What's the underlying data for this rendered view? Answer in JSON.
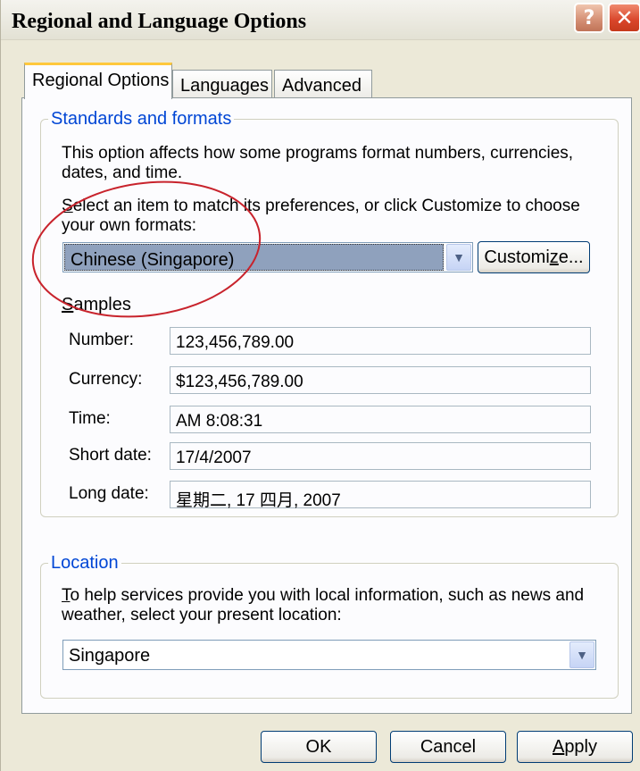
{
  "window": {
    "title": "Regional and Language Options"
  },
  "titlebar_buttons": {
    "help": "?",
    "close": "✕"
  },
  "tabs": [
    {
      "label": "Regional Options"
    },
    {
      "label": "Languages"
    },
    {
      "label": "Advanced"
    }
  ],
  "standards": {
    "legend": "Standards and formats",
    "desc_line1": "This option affects how some programs format numbers, currencies,",
    "desc_line2": "dates, and time.",
    "select_prefix": "S",
    "select_rest1": "elect an item to match its preferences, or click Customize to choose",
    "select_line2": "your own formats:",
    "format_value": "Chinese (Singapore)",
    "customize_prefix": "Customi",
    "customize_accel": "z",
    "customize_rest": "e...",
    "samples_accel": "S",
    "samples_rest": "amples",
    "samples": [
      {
        "label": "Number:",
        "value": "123,456,789.00"
      },
      {
        "label": "Currency:",
        "value": "$123,456,789.00"
      },
      {
        "label": "Time:",
        "value": "AM 8:08:31"
      },
      {
        "label": "Short date:",
        "value": "17/4/2007"
      },
      {
        "label": "Long date:",
        "value": "星期二, 17 四月, 2007"
      }
    ]
  },
  "location": {
    "legend": "Location",
    "desc_accel": "T",
    "desc_rest1": "o help services provide you with local information, such as news and",
    "desc_line2": "weather, select your present location:",
    "value": "Singapore"
  },
  "footer": {
    "ok": "OK",
    "cancel": "Cancel",
    "apply_accel": "A",
    "apply_rest": "pply"
  },
  "colors": {
    "highlight_circle": "#c8232c",
    "legend_text": "#0046d5",
    "selected_bg": "#8fa1bd"
  }
}
